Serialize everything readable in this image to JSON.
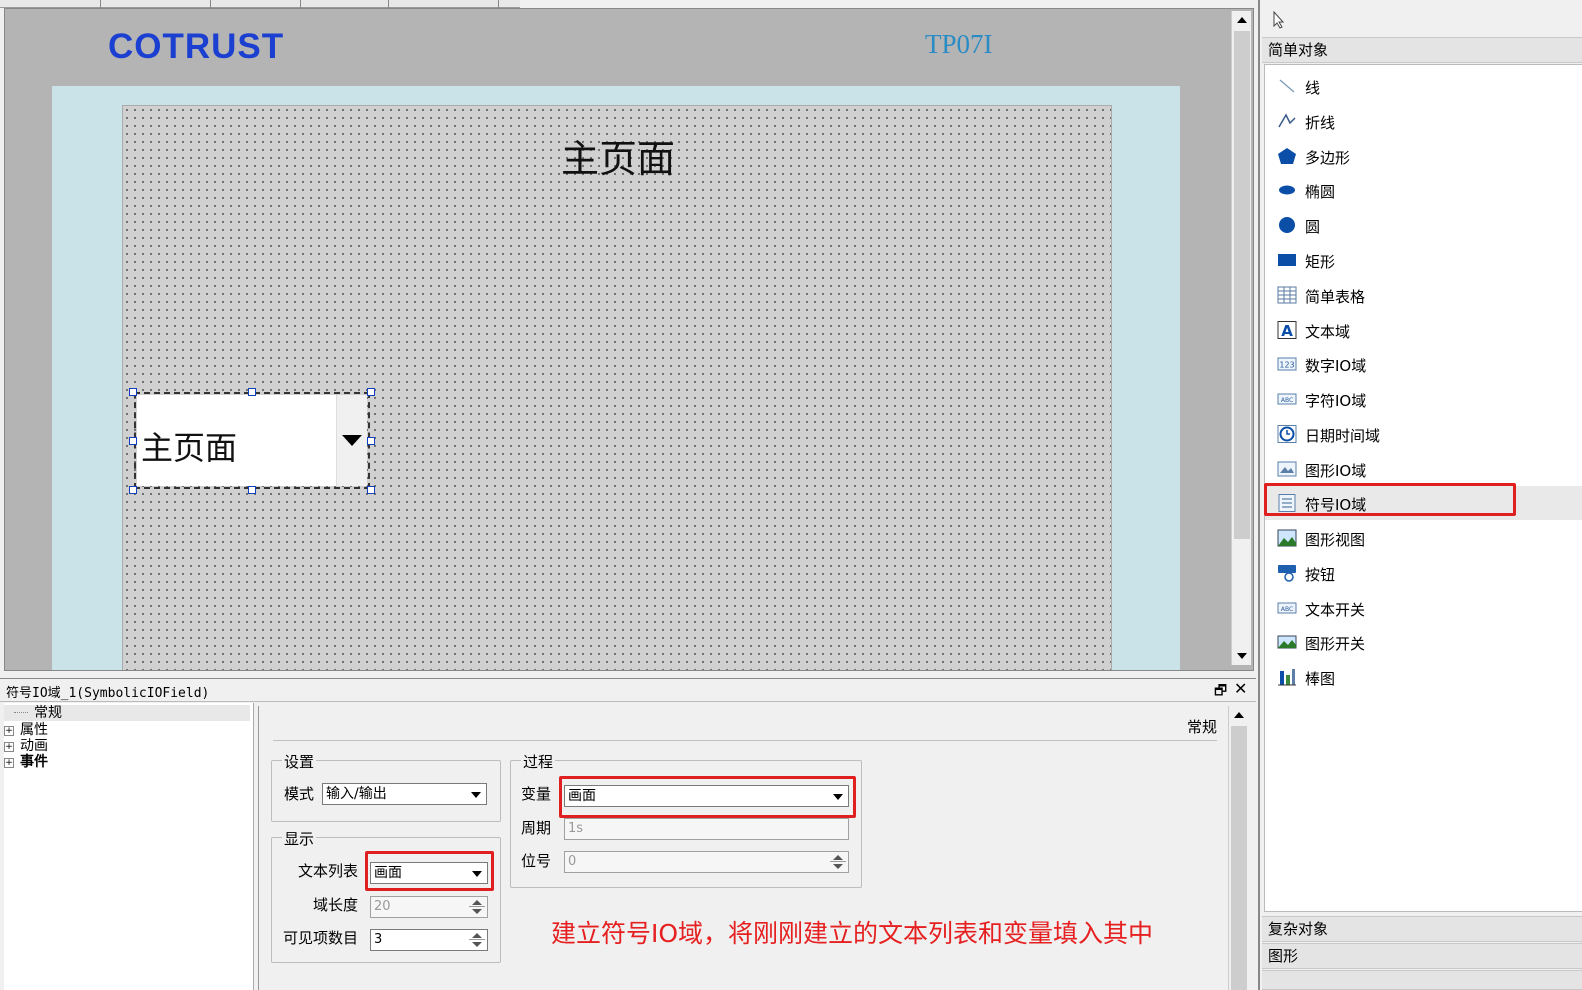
{
  "canvas": {
    "logo_text": "COTRUST",
    "model_label": "TP07I",
    "screen_title": "主页面",
    "symbolic_field_text": "主页面"
  },
  "props": {
    "title": "符号IO域_1(SymbolicIOField)",
    "tree": [
      {
        "label": "常规",
        "selected": true
      },
      {
        "label": "属性",
        "expandable": true
      },
      {
        "label": "动画",
        "expandable": true
      },
      {
        "label": "事件",
        "expandable": true,
        "bold": true
      }
    ],
    "section_name": "常规",
    "settings": {
      "legend": "设置",
      "mode_label": "模式",
      "mode_value": "输入/输出"
    },
    "display": {
      "legend": "显示",
      "textlist_label": "文本列表",
      "textlist_value": "画面",
      "field_length_label": "域长度",
      "field_length_value": "20",
      "visible_items_label": "可见项数目",
      "visible_items_value": "3"
    },
    "process": {
      "legend": "过程",
      "variable_label": "变量",
      "variable_value": "画面",
      "cycle_label": "周期",
      "cycle_value": "1s",
      "bit_label": "位号",
      "bit_value": "0"
    },
    "annotation": "建立符号IO域，将刚刚建立的文本列表和变量填入其中"
  },
  "toolbox": {
    "simple_header": "简单对象",
    "items": [
      {
        "label": "线",
        "icon": "line-icon"
      },
      {
        "label": "折线",
        "icon": "polyline-icon"
      },
      {
        "label": "多边形",
        "icon": "polygon-icon"
      },
      {
        "label": "椭圆",
        "icon": "ellipse-icon"
      },
      {
        "label": "圆",
        "icon": "circle-icon"
      },
      {
        "label": "矩形",
        "icon": "rectangle-icon"
      },
      {
        "label": "简单表格",
        "icon": "table-icon"
      },
      {
        "label": "文本域",
        "icon": "text-field-icon"
      },
      {
        "label": "数字IO域",
        "icon": "numeric-io-icon"
      },
      {
        "label": "字符IO域",
        "icon": "char-io-icon"
      },
      {
        "label": "日期时间域",
        "icon": "clock-icon"
      },
      {
        "label": "图形IO域",
        "icon": "graphic-io-icon"
      },
      {
        "label": "符号IO域",
        "icon": "symbolic-io-icon",
        "highlighted": true
      },
      {
        "label": "图形视图",
        "icon": "graphic-view-icon"
      },
      {
        "label": "按钮",
        "icon": "button-icon"
      },
      {
        "label": "文本开关",
        "icon": "text-switch-icon"
      },
      {
        "label": "图形开关",
        "icon": "graphic-switch-icon"
      },
      {
        "label": "棒图",
        "icon": "bar-graph-icon"
      }
    ],
    "complex_header": "复杂对象",
    "graphics_header": "图形"
  },
  "colors": {
    "accent_red": "#e02020",
    "logo_blue": "#1b3fd0",
    "model_blue": "#2a8cc4",
    "screen_bg": "#c9e3e8"
  }
}
